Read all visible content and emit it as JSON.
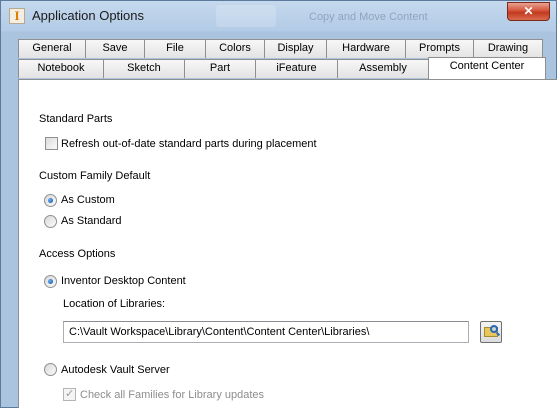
{
  "window": {
    "title": "Application Options",
    "close_glyph": "✕",
    "background_text": "Copy and Move Content"
  },
  "tabs_row1": [
    "General",
    "Save",
    "File",
    "Colors",
    "Display",
    "Hardware",
    "Prompts",
    "Drawing"
  ],
  "tabs_row2": [
    "Notebook",
    "Sketch",
    "Part",
    "iFeature",
    "Assembly",
    "Content Center"
  ],
  "active_tab": "Content Center",
  "standard_parts": {
    "heading": "Standard Parts",
    "refresh_label": "Refresh out-of-date standard parts during placement",
    "refresh_checked": false
  },
  "custom_family": {
    "heading": "Custom Family Default",
    "options": [
      "As Custom",
      "As Standard"
    ],
    "selected": "As Custom"
  },
  "access": {
    "heading": "Access Options",
    "desktop_label": "Inventor Desktop Content",
    "desktop_selected": true,
    "location_label": "Location of Libraries:",
    "location_value": "C:\\Vault Workspace\\Library\\Content\\Content Center\\Libraries\\",
    "vault_label": "Autodesk Vault Server",
    "vault_selected": false,
    "check_families_label": "Check all Families for Library updates",
    "check_families_checked": true
  },
  "icons": {
    "app": "inventor-app-icon",
    "browse": "folder-search-icon"
  }
}
